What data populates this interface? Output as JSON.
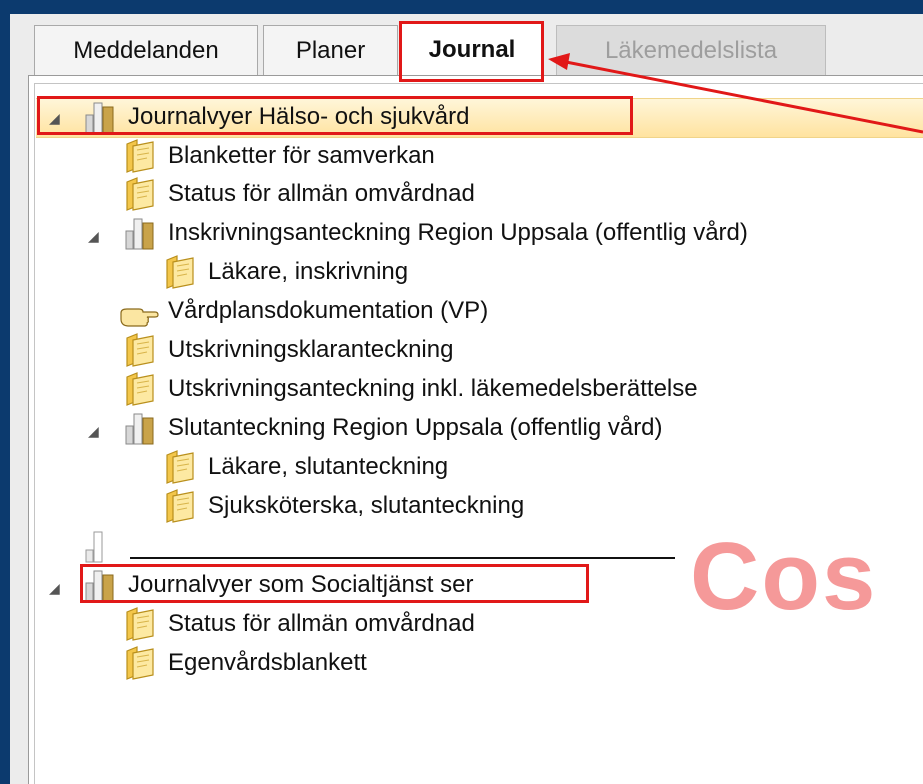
{
  "tabs": [
    {
      "label": "Meddelanden",
      "state": "normal"
    },
    {
      "label": "Planer",
      "state": "normal"
    },
    {
      "label": "Journal",
      "state": "active"
    },
    {
      "label": "Läkemedelslista",
      "state": "disabled"
    }
  ],
  "tree": {
    "group1": {
      "label": "Journalvyer Hälso- och sjukvård",
      "children": [
        "Blanketter för samverkan",
        "Status för allmän omvårdnad"
      ],
      "sub1": {
        "label": "Inskrivningsanteckning Region Uppsala (offentlig vård)",
        "children": [
          "Läkare, inskrivning"
        ]
      },
      "vp_item": "Vårdplansdokumentation (VP)",
      "more_children": [
        "Utskrivningsklaranteckning",
        "Utskrivningsanteckning inkl. läkemedelsberättelse"
      ],
      "sub2": {
        "label": "Slutanteckning Region Uppsala (offentlig vård)",
        "children": [
          "Läkare, slutanteckning",
          "Sjuksköterska, slutanteckning"
        ]
      }
    },
    "separator_label": "",
    "group2": {
      "label": "Journalvyer som Socialtjänst ser",
      "children": [
        "Status för allmän omvårdnad",
        "Egenvårdsblankett"
      ]
    }
  },
  "watermark": "Cos",
  "colors": {
    "highlight": "#ffe3a0",
    "annotation_red": "#e11818",
    "frame": "#0c3a6e"
  },
  "icons": {
    "expander": "triangle-down-icon",
    "folder": "folder-icon",
    "journal_group": "binder-icon",
    "hand": "hand-pointer-icon"
  }
}
